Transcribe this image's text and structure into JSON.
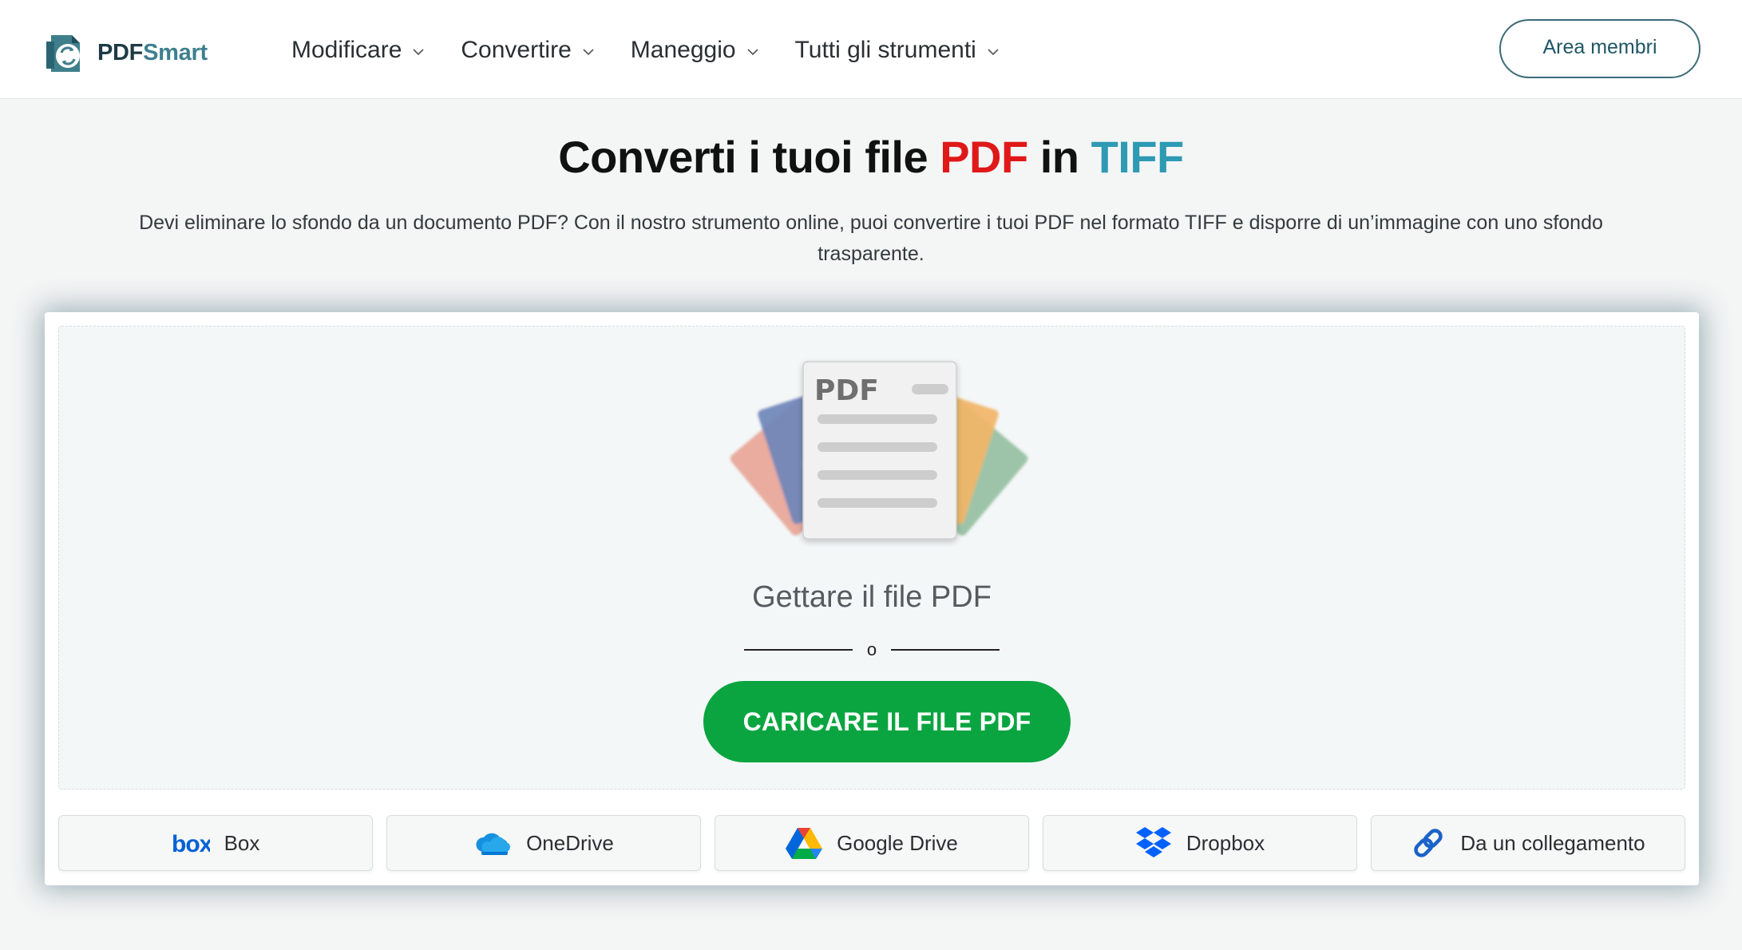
{
  "header": {
    "logo": {
      "part1": "PDF",
      "part2": "Smart"
    },
    "nav": [
      {
        "label": "Modificare"
      },
      {
        "label": "Convertire"
      },
      {
        "label": "Maneggio"
      },
      {
        "label": "Tutti gli strumenti"
      }
    ],
    "member_button": "Area membri"
  },
  "hero": {
    "title_prefix": "Converti i tuoi file ",
    "title_pdf": "PDF",
    "title_mid": " in ",
    "title_tiff": "TIFF",
    "subtitle": "Devi eliminare lo sfondo da un documento PDF? Con il nostro strumento online, puoi convertire i tuoi PDF nel formato TIFF e disporre di un’immagine con uno sfondo trasparente."
  },
  "upload": {
    "doc_label": "PDF",
    "drop_text": "Gettare il file PDF",
    "or_text": "o",
    "upload_button": "CARICARE IL FILE PDF",
    "sources": [
      {
        "label": "Box",
        "icon": "box-icon"
      },
      {
        "label": "OneDrive",
        "icon": "onedrive-icon"
      },
      {
        "label": "Google Drive",
        "icon": "google-drive-icon"
      },
      {
        "label": "Dropbox",
        "icon": "dropbox-icon"
      },
      {
        "label": "Da un collegamento",
        "icon": "link-icon"
      }
    ]
  },
  "colors": {
    "accent_red": "#e01818",
    "accent_teal": "#2e9ab3",
    "upload_green": "#0aa540",
    "brand_dark": "#1d3b45"
  }
}
